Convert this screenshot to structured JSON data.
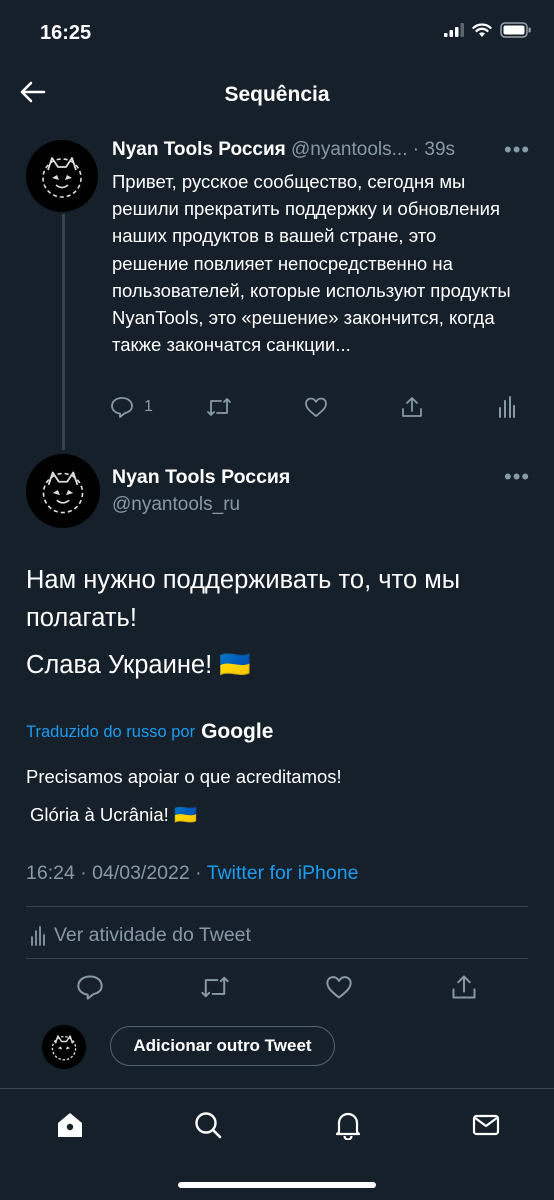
{
  "status_bar": {
    "time": "16:25"
  },
  "header": {
    "title": "Sequência"
  },
  "thread_tweet": {
    "display_name": "Nyan Tools Россия",
    "handle": "@nyantools...",
    "time": "· 39s",
    "more": "•••",
    "text": "Привет, русское сообщество, сегодня мы решили прекратить поддержку и обновления наших продуктов в вашей стране, это решение повлияет непосредственно на пользователей, которые используют продукты NyanTools, это «решение» закончится, когда также закончатся санкции...",
    "reply_count": "1"
  },
  "main_tweet": {
    "display_name": "Nyan Tools Россия",
    "handle": "@nyantools_ru",
    "more": "•••",
    "text_line1": "Нам нужно поддерживать то, что мы  полагать!",
    "text_line2": "Слава Украине! 🇺🇦",
    "translated_label": "Traduzido do russo por",
    "translator_brand": "Google",
    "translation_line1": "Precisamos apoiar o que acreditamos!",
    "translation_line2": "Glória à Ucrânia! 🇺🇦",
    "timestamp": "16:24 · 04/03/2022 · ",
    "source": "Twitter for iPhone",
    "activity_label": "Ver atividade do Tweet"
  },
  "composer": {
    "button_label": "Adicionar outro Tweet"
  },
  "colors": {
    "background": "#15202b",
    "accent": "#1d9bf0",
    "muted": "#8899a6",
    "divider": "#38444d"
  }
}
